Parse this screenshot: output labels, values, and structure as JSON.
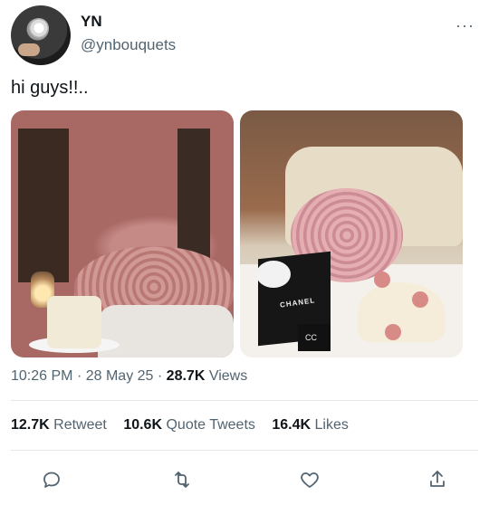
{
  "author": {
    "display_name": "YN",
    "handle": "@ynbouquets",
    "avatar_icon": "bouquet-avatar"
  },
  "tweet": {
    "text": "hi guys!!.."
  },
  "media": [
    {
      "description_icon": "restaurant-bouquet-photo"
    },
    {
      "description_icon": "pink-rose-bouquet-chanel-bag-photo",
      "bag_text": "CHANEL",
      "logo_text": "CC"
    }
  ],
  "meta": {
    "time": "10:26 PM",
    "separator": "·",
    "date": "28 May 25",
    "views_count": "28.7K",
    "views_label": "Views"
  },
  "stats": {
    "retweets_count": "12.7K",
    "retweets_label": "Retweet",
    "quotes_count": "10.6K",
    "quotes_label": "Quote Tweets",
    "likes_count": "16.4K",
    "likes_label": "Likes"
  },
  "more_label": "···",
  "colors": {
    "text_primary": "#0f1419",
    "text_secondary": "#536471",
    "divider": "#e5e8eb"
  },
  "actions": [
    "reply-icon",
    "retweet-icon",
    "like-icon",
    "share-icon"
  ]
}
